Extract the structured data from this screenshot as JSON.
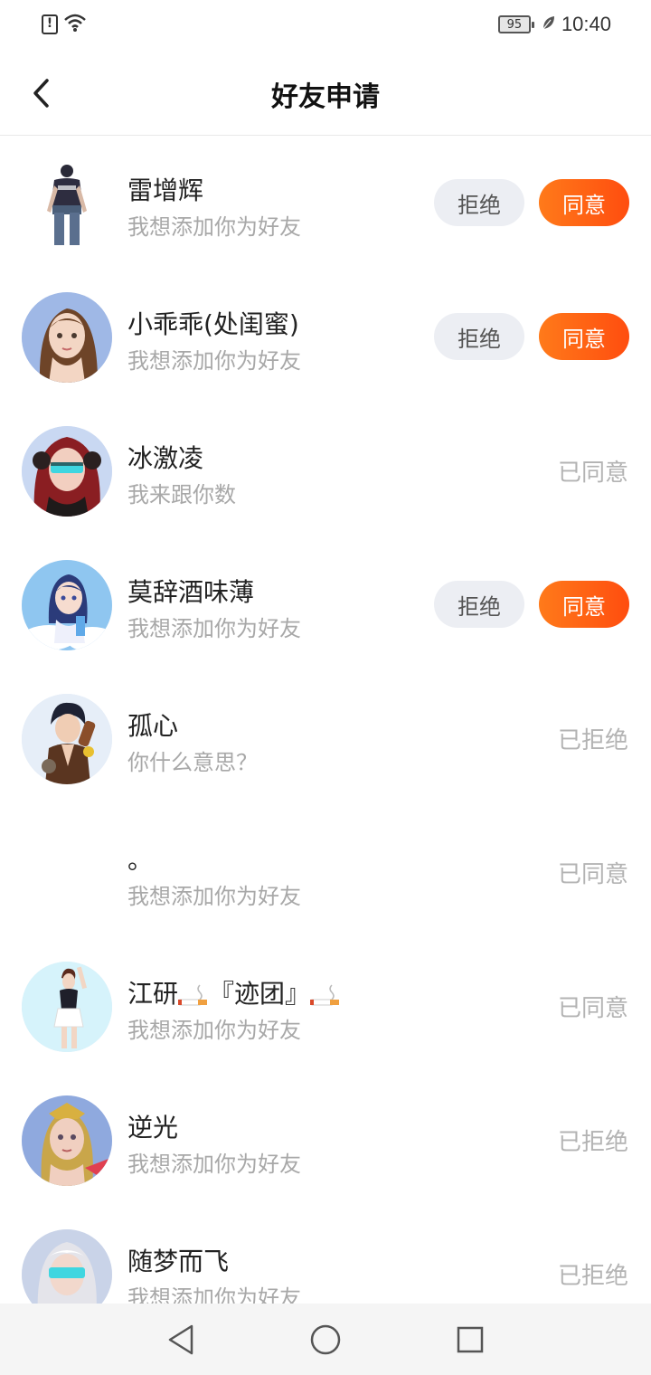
{
  "status_bar": {
    "battery": "95",
    "time": "10:40"
  },
  "header": {
    "title": "好友申请"
  },
  "requests": [
    {
      "name": "雷增辉",
      "message": "我想添加你为好友",
      "reject_label": "拒绝",
      "accept_label": "同意"
    },
    {
      "name": "小乖乖(处闺蜜)",
      "message": "我想添加你为好友",
      "reject_label": "拒绝",
      "accept_label": "同意"
    },
    {
      "name": "冰激凌",
      "message": "我来跟你数",
      "status": "已同意"
    },
    {
      "name": "莫辞酒味薄",
      "message": "我想添加你为好友",
      "reject_label": "拒绝",
      "accept_label": "同意"
    },
    {
      "name": "孤心",
      "message": "你什么意思？",
      "status": "已拒绝"
    },
    {
      "name": "。",
      "message": "我想添加你为好友",
      "status": "已同意"
    },
    {
      "name_part1": "江研",
      "name_part2": "『迹团』",
      "message": "我想添加你为好友",
      "status": "已同意"
    },
    {
      "name": "逆光",
      "message": "我想添加你为好友",
      "status": "已拒绝"
    },
    {
      "name": "随梦而飞",
      "message": "我想添加你为好友",
      "status": "已拒绝"
    }
  ],
  "icons": {
    "back": "chevron-left-icon",
    "nav_back": "triangle-back-icon",
    "nav_home": "circle-home-icon",
    "nav_recent": "square-recent-icon"
  },
  "colors": {
    "accent": "#ff5a14",
    "reject_bg": "#eceef3"
  }
}
